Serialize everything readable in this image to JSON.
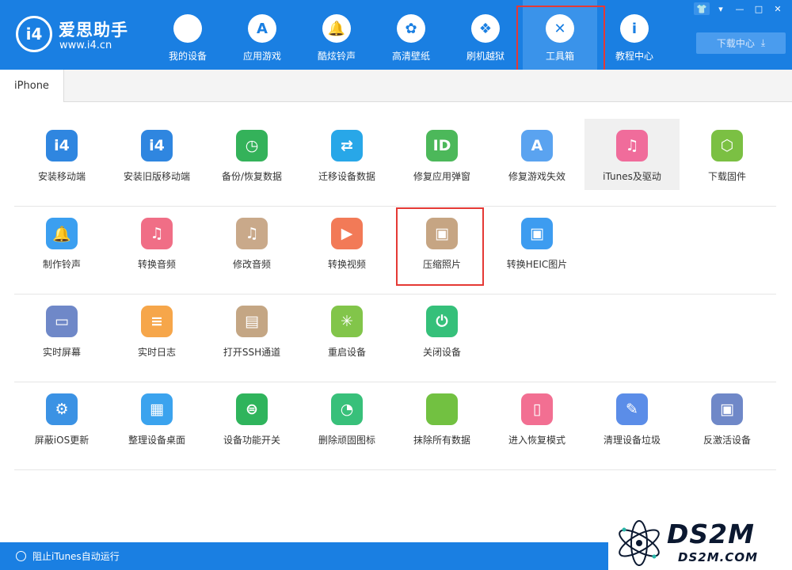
{
  "header": {
    "brand_name": "爱思助手",
    "brand_url": "www.i4.cn",
    "logo_text": "i4",
    "download_label": "下载中心",
    "nav": [
      {
        "label": "我的设备",
        "icon": "apple-icon",
        "glyph": ""
      },
      {
        "label": "应用游戏",
        "icon": "app-store-icon",
        "glyph": "A"
      },
      {
        "label": "酷炫铃声",
        "icon": "bell-icon",
        "glyph": "🔔"
      },
      {
        "label": "高清壁纸",
        "icon": "flower-icon",
        "glyph": "✿"
      },
      {
        "label": "刷机越狱",
        "icon": "dropbox-icon",
        "glyph": "❖"
      },
      {
        "label": "工具箱",
        "icon": "tools-icon",
        "glyph": "✕",
        "active": true
      },
      {
        "label": "教程中心",
        "icon": "info-icon",
        "glyph": "i"
      }
    ],
    "window_controls": [
      "👕",
      "▾",
      "—",
      "□",
      "✕"
    ]
  },
  "tabs": {
    "device": "iPhone"
  },
  "tools": {
    "rows": [
      [
        {
          "label": "安装移动端",
          "icon": "i4-icon",
          "glyph": "i4",
          "color": "#2f86e0"
        },
        {
          "label": "安装旧版移动端",
          "icon": "i4-legacy-icon",
          "glyph": "i4",
          "color": "#2f86e0"
        },
        {
          "label": "备份/恢复数据",
          "icon": "backup-clock-icon",
          "glyph": "◷",
          "color": "#34b25a"
        },
        {
          "label": "迁移设备数据",
          "icon": "transfer-icon",
          "glyph": "⇄",
          "color": "#28a7e8"
        },
        {
          "label": "修复应用弹窗",
          "icon": "apple-id-icon",
          "glyph": "ID",
          "color": "#4cb85a"
        },
        {
          "label": "修复游戏失效",
          "icon": "app-store-repair-icon",
          "glyph": "A",
          "color": "#5aa3f0"
        },
        {
          "label": "iTunes及驱动",
          "icon": "itunes-icon",
          "glyph": "♫",
          "color": "#f06c9b",
          "highlight": true
        },
        {
          "label": "下载固件",
          "icon": "firmware-box-icon",
          "glyph": "⬡",
          "color": "#7bc043"
        }
      ],
      [
        {
          "label": "制作铃声",
          "icon": "ringtone-bell-icon",
          "glyph": "🔔",
          "color": "#3b9ff0"
        },
        {
          "label": "转换音频",
          "icon": "music-note-icon",
          "glyph": "♫",
          "color": "#f06e86"
        },
        {
          "label": "修改音频",
          "icon": "audio-edit-icon",
          "glyph": "♫",
          "color": "#c9a98a"
        },
        {
          "label": "转换视频",
          "icon": "video-play-icon",
          "glyph": "▶",
          "color": "#f27a57"
        },
        {
          "label": "压缩照片",
          "icon": "photo-icon",
          "glyph": "▣",
          "color": "#c6a583"
        },
        {
          "label": "转换HEIC图片",
          "icon": "heic-image-icon",
          "glyph": "▣",
          "color": "#3d9cf0"
        }
      ],
      [
        {
          "label": "实时屏幕",
          "icon": "monitor-icon",
          "glyph": "▭",
          "color": "#6f88c8"
        },
        {
          "label": "实时日志",
          "icon": "log-document-icon",
          "glyph": "≡",
          "color": "#f6a64a"
        },
        {
          "label": "打开SSH通道",
          "icon": "ssh-terminal-icon",
          "glyph": "▤",
          "color": "#c4a684"
        },
        {
          "label": "重启设备",
          "icon": "restart-icon",
          "glyph": "✳",
          "color": "#82c54a"
        },
        {
          "label": "关闭设备",
          "icon": "power-icon",
          "glyph": "⏻",
          "color": "#35c07a"
        }
      ],
      [
        {
          "label": "屏蔽iOS更新",
          "icon": "block-update-gear-icon",
          "glyph": "⚙",
          "color": "#3b92e4"
        },
        {
          "label": "整理设备桌面",
          "icon": "grid-icon",
          "glyph": "▦",
          "color": "#3ba3ee"
        },
        {
          "label": "设备功能开关",
          "icon": "toggle-icon",
          "glyph": "⊜",
          "color": "#2fb45c"
        },
        {
          "label": "删除顽固图标",
          "icon": "pie-icon",
          "glyph": "◔",
          "color": "#38c07a"
        },
        {
          "label": "抹除所有数据",
          "icon": "erase-apple-icon",
          "glyph": "",
          "color": "#72c141"
        },
        {
          "label": "进入恢复模式",
          "icon": "recovery-phone-icon",
          "glyph": "▯",
          "color": "#f26f92"
        },
        {
          "label": "清理设备垃圾",
          "icon": "broom-icon",
          "glyph": "✎",
          "color": "#5b8de8"
        },
        {
          "label": "反激活设备",
          "icon": "deactivate-tablet-icon",
          "glyph": "▣",
          "color": "#6f88c8"
        }
      ]
    ]
  },
  "footer": {
    "itunes_label": "阻止iTunes自动运行"
  },
  "watermark": {
    "big": "DS2M",
    "small": "DS2M.COM"
  }
}
